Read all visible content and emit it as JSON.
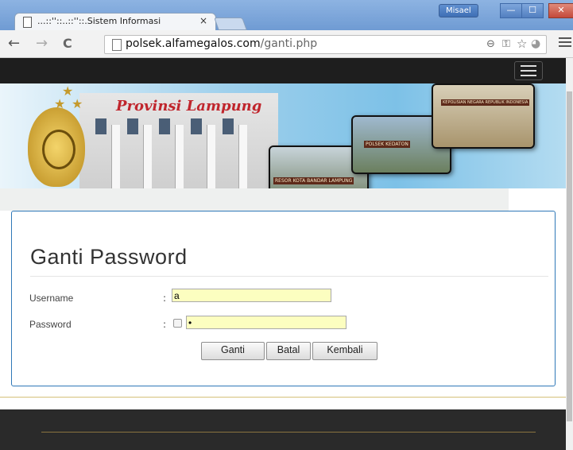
{
  "browser": {
    "tab_title": "...::''::..::''::.Sistem Informasi",
    "tab_close": "×",
    "user_label": "Misael",
    "window_controls": [
      "—",
      "☐",
      "✕"
    ],
    "url_host": "polsek.alfamegalos.com",
    "url_path": "/ganti.php",
    "nav": {
      "back": "←",
      "forward": "→",
      "reload": "C"
    }
  },
  "banner": {
    "province_text": "Provinsi Lampung",
    "photo_signs": [
      "POLSEK KEDATON",
      "RESOR KOTA BANDAR LAMPUNG",
      "KEPOLISIAN NEGARA REPUBLIK INDONESIA"
    ]
  },
  "form": {
    "title": "Ganti Password",
    "username_label": "Username",
    "password_label": "Password",
    "colon": ":",
    "username_value": "a",
    "password_value": "•",
    "buttons": {
      "ganti": "Ganti",
      "batal": "Batal",
      "kembali": "Kembali"
    }
  },
  "colors": {
    "panel_border": "#2f78b8",
    "input_bg": "#fcfec0",
    "navbar": "#1e1e1e"
  }
}
